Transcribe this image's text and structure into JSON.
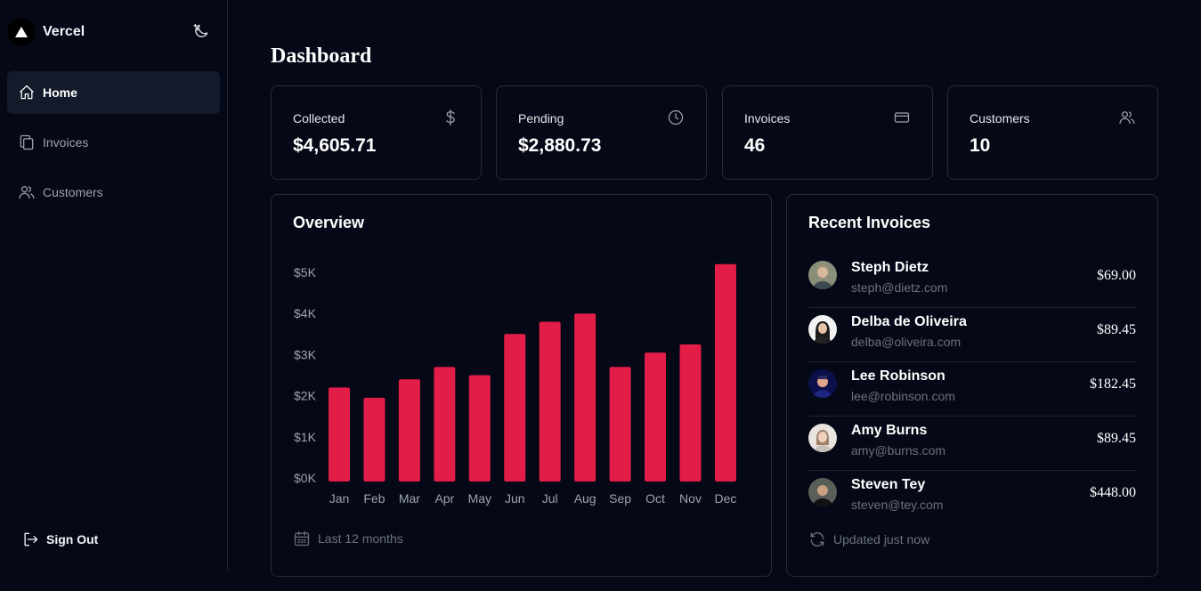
{
  "brand": {
    "name": "Vercel"
  },
  "sidebar": {
    "items": [
      {
        "label": "Home",
        "icon": "home-icon",
        "active": true
      },
      {
        "label": "Invoices",
        "icon": "document-duplicate-icon",
        "active": false
      },
      {
        "label": "Customers",
        "icon": "users-icon",
        "active": false
      }
    ],
    "signout_label": "Sign Out"
  },
  "page": {
    "title": "Dashboard"
  },
  "stats": [
    {
      "label": "Collected",
      "value": "$4,605.71",
      "icon": "dollar-icon"
    },
    {
      "label": "Pending",
      "value": "$2,880.73",
      "icon": "clock-icon"
    },
    {
      "label": "Invoices",
      "value": "46",
      "icon": "card-icon"
    },
    {
      "label": "Customers",
      "value": "10",
      "icon": "users-icon"
    }
  ],
  "overview": {
    "title": "Overview",
    "footer": "Last 12 months"
  },
  "chart_data": {
    "type": "bar",
    "title": "Overview",
    "categories": [
      "Jan",
      "Feb",
      "Mar",
      "Apr",
      "May",
      "Jun",
      "Jul",
      "Aug",
      "Sep",
      "Oct",
      "Nov",
      "Dec"
    ],
    "values": [
      2200,
      1950,
      2400,
      2700,
      2500,
      3500,
      3800,
      4000,
      2700,
      3050,
      3250,
      5200
    ],
    "yticks": [
      "$0K",
      "$1K",
      "$2K",
      "$3K",
      "$4K",
      "$5K"
    ],
    "ylim": [
      0,
      5000
    ],
    "grid": false,
    "color": "#e11d48"
  },
  "recent": {
    "title": "Recent Invoices",
    "footer": "Updated just now",
    "invoices": [
      {
        "name": "Steph Dietz",
        "email": "steph@dietz.com",
        "amount": "$69.00"
      },
      {
        "name": "Delba de Oliveira",
        "email": "delba@oliveira.com",
        "amount": "$89.45"
      },
      {
        "name": "Lee Robinson",
        "email": "lee@robinson.com",
        "amount": "$182.45"
      },
      {
        "name": "Amy Burns",
        "email": "amy@burns.com",
        "amount": "$89.45"
      },
      {
        "name": "Steven Tey",
        "email": "steven@tey.com",
        "amount": "$448.00"
      }
    ]
  },
  "colors": {
    "background": "#050816",
    "accent_bar": "#e11d48",
    "muted_text": "#6b7280",
    "border": "#252b3b"
  }
}
